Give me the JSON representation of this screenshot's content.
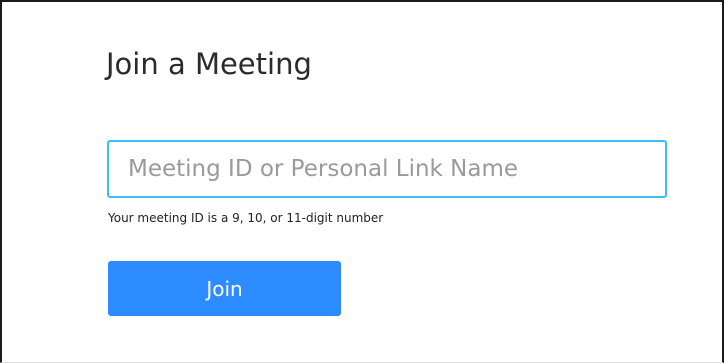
{
  "page": {
    "title": "Join a Meeting"
  },
  "form": {
    "meeting_id_value": "",
    "meeting_id_placeholder": "Meeting ID or Personal Link Name",
    "helper_text": "Your meeting ID is a 9, 10, or 11-digit number",
    "join_label": "Join"
  },
  "colors": {
    "accent": "#2d8cff",
    "input_focus_border": "#3cbdf3",
    "title_text": "#2b2b2b",
    "placeholder_text": "#9a9a9a"
  }
}
